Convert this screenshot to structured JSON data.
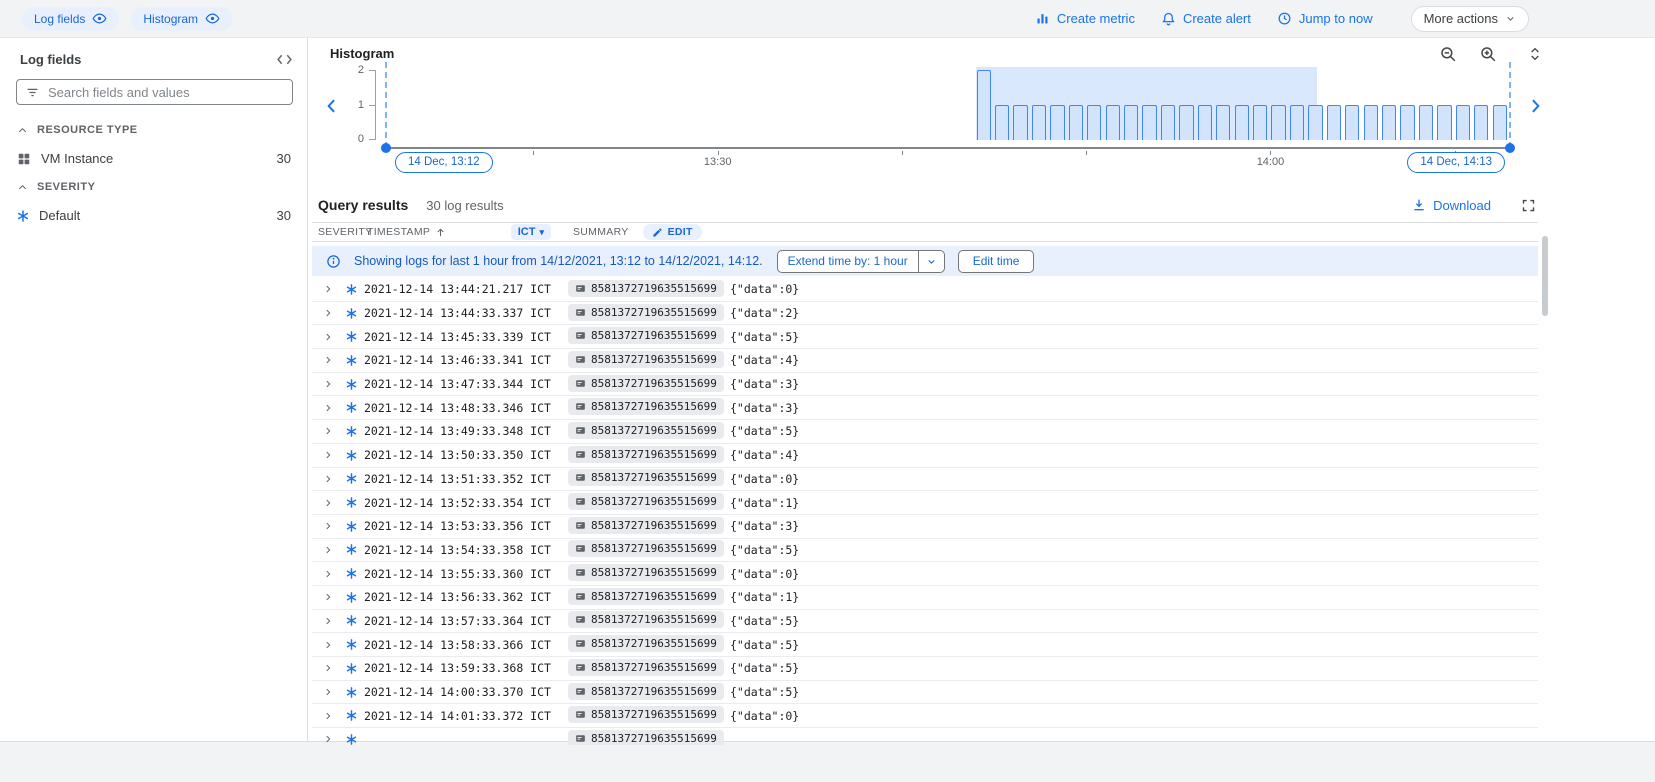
{
  "topbar": {
    "chips": [
      {
        "label": "Log fields"
      },
      {
        "label": "Histogram"
      }
    ],
    "actions": [
      {
        "label": "Create metric"
      },
      {
        "label": "Create alert"
      },
      {
        "label": "Jump to now"
      }
    ],
    "more_actions_label": "More actions"
  },
  "log_fields_panel": {
    "title": "Log fields",
    "search_placeholder": "Search fields and values",
    "sections": [
      {
        "title": "RESOURCE TYPE",
        "items": [
          {
            "label": "VM Instance",
            "count": "30"
          }
        ]
      },
      {
        "title": "SEVERITY",
        "items": [
          {
            "label": "Default",
            "count": "30"
          }
        ]
      }
    ]
  },
  "histogram": {
    "title": "Histogram",
    "start_label": "14 Dec, 13:12",
    "end_label": "14 Dec, 14:13",
    "chart_data": {
      "type": "bar",
      "title": "Histogram",
      "ylim": [
        0,
        2
      ],
      "y_ticks": [
        "2",
        "1",
        "0"
      ],
      "x_axis_start": "13:12",
      "x_axis_end": "14:13",
      "total_minutes": 61,
      "x_tick_labels": [
        {
          "label": "13:30",
          "minute_offset": 18
        },
        {
          "label": "14:00",
          "minute_offset": 48
        }
      ],
      "x_minor_tick_minutes": [
        8,
        18,
        28,
        38,
        48,
        58
      ],
      "bars_start_minute_offset": 32,
      "values": [
        2,
        1,
        1,
        1,
        1,
        1,
        1,
        1,
        1,
        1,
        1,
        1,
        1,
        1,
        1,
        1,
        1,
        1,
        1,
        1,
        1,
        1,
        1,
        1,
        1,
        1,
        1,
        1,
        1
      ],
      "selection_minutes": [
        32,
        50.5
      ]
    }
  },
  "query_results": {
    "title": "Query results",
    "results_count": "30 log results",
    "download_label": "Download",
    "table_header": {
      "severity": "SEVERITY",
      "timestamp": "TIMESTAMP",
      "timezone": "ICT",
      "summary": "SUMMARY",
      "edit": "EDIT"
    },
    "banner": {
      "message": "Showing logs for last 1 hour from 14/12/2021, 13:12 to 14/12/2021, 14:12.",
      "extend_label": "Extend time by: 1 hour",
      "edit_time_label": "Edit time"
    },
    "rows": [
      {
        "timestamp": "2021-12-14 13:44:21.217 ICT",
        "resource_id": "8581372719635515699",
        "summary": "{\"data\":0}"
      },
      {
        "timestamp": "2021-12-14 13:44:33.337 ICT",
        "resource_id": "8581372719635515699",
        "summary": "{\"data\":2}"
      },
      {
        "timestamp": "2021-12-14 13:45:33.339 ICT",
        "resource_id": "8581372719635515699",
        "summary": "{\"data\":5}"
      },
      {
        "timestamp": "2021-12-14 13:46:33.341 ICT",
        "resource_id": "8581372719635515699",
        "summary": "{\"data\":4}"
      },
      {
        "timestamp": "2021-12-14 13:47:33.344 ICT",
        "resource_id": "8581372719635515699",
        "summary": "{\"data\":3}"
      },
      {
        "timestamp": "2021-12-14 13:48:33.346 ICT",
        "resource_id": "8581372719635515699",
        "summary": "{\"data\":3}"
      },
      {
        "timestamp": "2021-12-14 13:49:33.348 ICT",
        "resource_id": "8581372719635515699",
        "summary": "{\"data\":5}"
      },
      {
        "timestamp": "2021-12-14 13:50:33.350 ICT",
        "resource_id": "8581372719635515699",
        "summary": "{\"data\":4}"
      },
      {
        "timestamp": "2021-12-14 13:51:33.352 ICT",
        "resource_id": "8581372719635515699",
        "summary": "{\"data\":0}"
      },
      {
        "timestamp": "2021-12-14 13:52:33.354 ICT",
        "resource_id": "8581372719635515699",
        "summary": "{\"data\":1}"
      },
      {
        "timestamp": "2021-12-14 13:53:33.356 ICT",
        "resource_id": "8581372719635515699",
        "summary": "{\"data\":3}"
      },
      {
        "timestamp": "2021-12-14 13:54:33.358 ICT",
        "resource_id": "8581372719635515699",
        "summary": "{\"data\":5}"
      },
      {
        "timestamp": "2021-12-14 13:55:33.360 ICT",
        "resource_id": "8581372719635515699",
        "summary": "{\"data\":0}"
      },
      {
        "timestamp": "2021-12-14 13:56:33.362 ICT",
        "resource_id": "8581372719635515699",
        "summary": "{\"data\":1}"
      },
      {
        "timestamp": "2021-12-14 13:57:33.364 ICT",
        "resource_id": "8581372719635515699",
        "summary": "{\"data\":5}"
      },
      {
        "timestamp": "2021-12-14 13:58:33.366 ICT",
        "resource_id": "8581372719635515699",
        "summary": "{\"data\":5}"
      },
      {
        "timestamp": "2021-12-14 13:59:33.368 ICT",
        "resource_id": "8581372719635515699",
        "summary": "{\"data\":5}"
      },
      {
        "timestamp": "2021-12-14 14:00:33.370 ICT",
        "resource_id": "8581372719635515699",
        "summary": "{\"data\":5}"
      },
      {
        "timestamp": "2021-12-14 14:01:33.372 ICT",
        "resource_id": "8581372719635515699",
        "summary": "{\"data\":0}"
      },
      {
        "timestamp": "",
        "resource_id": "8581372719635515699",
        "summary": ""
      }
    ]
  },
  "colors": {
    "accent_blue": "#1a73e8",
    "chip_blue_bg": "#e8f0fe",
    "chip_blue_text": "#1967d2",
    "banner_bg": "#e8f0fe",
    "bar_fill": "#d2e3fc",
    "bar_border": "#4285f4",
    "topbar_bg": "#f1f3f4"
  }
}
